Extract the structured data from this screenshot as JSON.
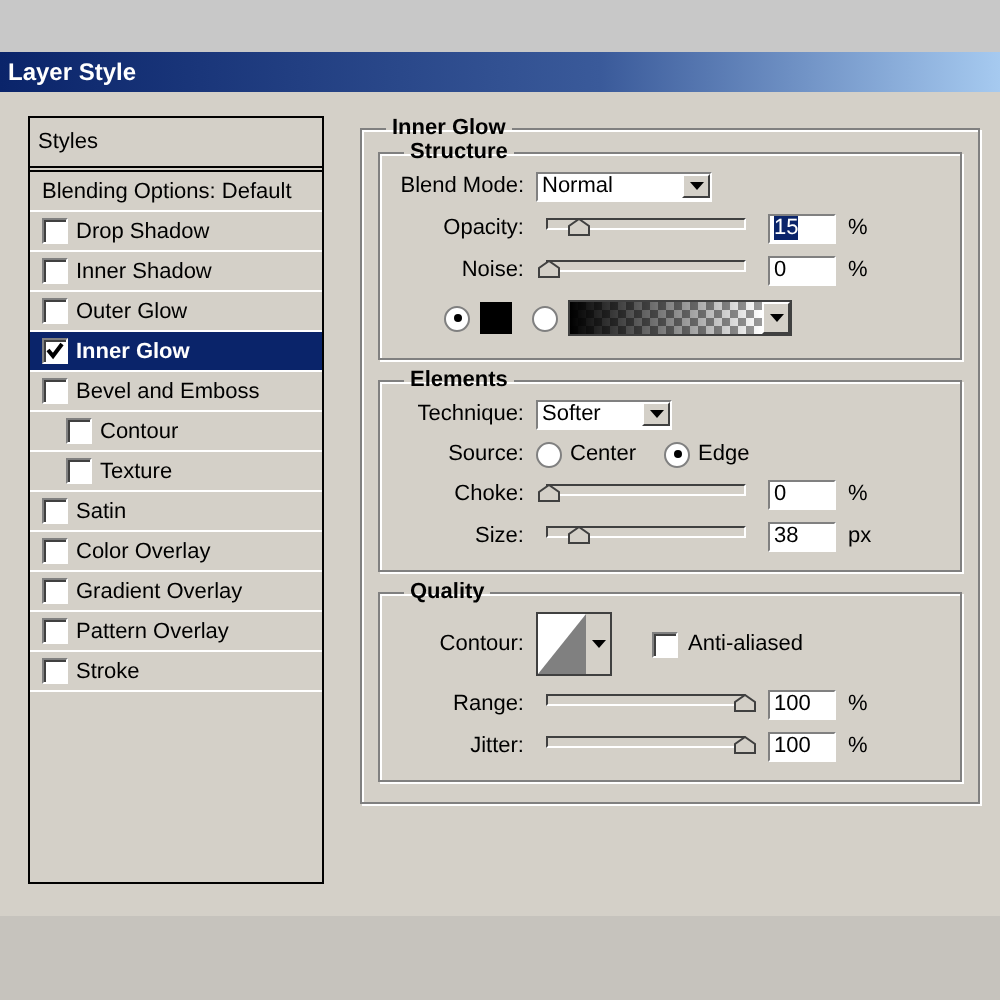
{
  "window": {
    "title": "Layer Style"
  },
  "styles_panel": {
    "header": "Styles",
    "blending_options": "Blending Options: Default",
    "items": [
      {
        "label": "Drop Shadow",
        "checked": false,
        "selected": false,
        "kind": "top"
      },
      {
        "label": "Inner Shadow",
        "checked": false,
        "selected": false,
        "kind": "top"
      },
      {
        "label": "Outer Glow",
        "checked": false,
        "selected": false,
        "kind": "top"
      },
      {
        "label": "Inner Glow",
        "checked": true,
        "selected": true,
        "kind": "top"
      },
      {
        "label": "Bevel and Emboss",
        "checked": false,
        "selected": false,
        "kind": "top"
      },
      {
        "label": "Contour",
        "checked": false,
        "selected": false,
        "kind": "sub"
      },
      {
        "label": "Texture",
        "checked": false,
        "selected": false,
        "kind": "sub"
      },
      {
        "label": "Satin",
        "checked": false,
        "selected": false,
        "kind": "top"
      },
      {
        "label": "Color Overlay",
        "checked": false,
        "selected": false,
        "kind": "top"
      },
      {
        "label": "Gradient Overlay",
        "checked": false,
        "selected": false,
        "kind": "top"
      },
      {
        "label": "Pattern Overlay",
        "checked": false,
        "selected": false,
        "kind": "top"
      },
      {
        "label": "Stroke",
        "checked": false,
        "selected": false,
        "kind": "top"
      }
    ]
  },
  "inner_glow": {
    "title": "Inner Glow",
    "structure": {
      "title": "Structure",
      "blend_mode": {
        "label": "Blend Mode:",
        "value": "Normal"
      },
      "sliders": [
        {
          "label": "Opacity:",
          "level": 0.15,
          "value": "15",
          "unit": "%",
          "text_selected": true
        },
        {
          "label": "Noise:",
          "level": 0,
          "value": "0",
          "unit": "%",
          "text_selected": false
        }
      ],
      "fill_options": [
        {
          "kind": "color",
          "selected": true,
          "color": "#000000"
        },
        {
          "kind": "gradient",
          "selected": false
        }
      ]
    },
    "elements": {
      "title": "Elements",
      "technique": {
        "label": "Technique:",
        "value": "Softer"
      },
      "source": {
        "label": "Source:",
        "options": [
          {
            "label": "Center",
            "selected": false
          },
          {
            "label": "Edge",
            "selected": true
          }
        ]
      },
      "sliders": [
        {
          "label": "Choke:",
          "level": 0,
          "value": "0",
          "unit": "%",
          "text_selected": false
        },
        {
          "label": "Size:",
          "level": 0.15,
          "value": "38",
          "unit": "px",
          "text_selected": false
        }
      ]
    },
    "quality": {
      "title": "Quality",
      "contour_label": "Contour:",
      "anti_aliased": {
        "label": "Anti-aliased",
        "checked": false
      },
      "sliders": [
        {
          "label": "Range:",
          "level": 1,
          "value": "100",
          "unit": "%",
          "text_selected": false
        },
        {
          "label": "Jitter:",
          "level": 1,
          "value": "100",
          "unit": "%",
          "text_selected": false
        }
      ]
    }
  }
}
